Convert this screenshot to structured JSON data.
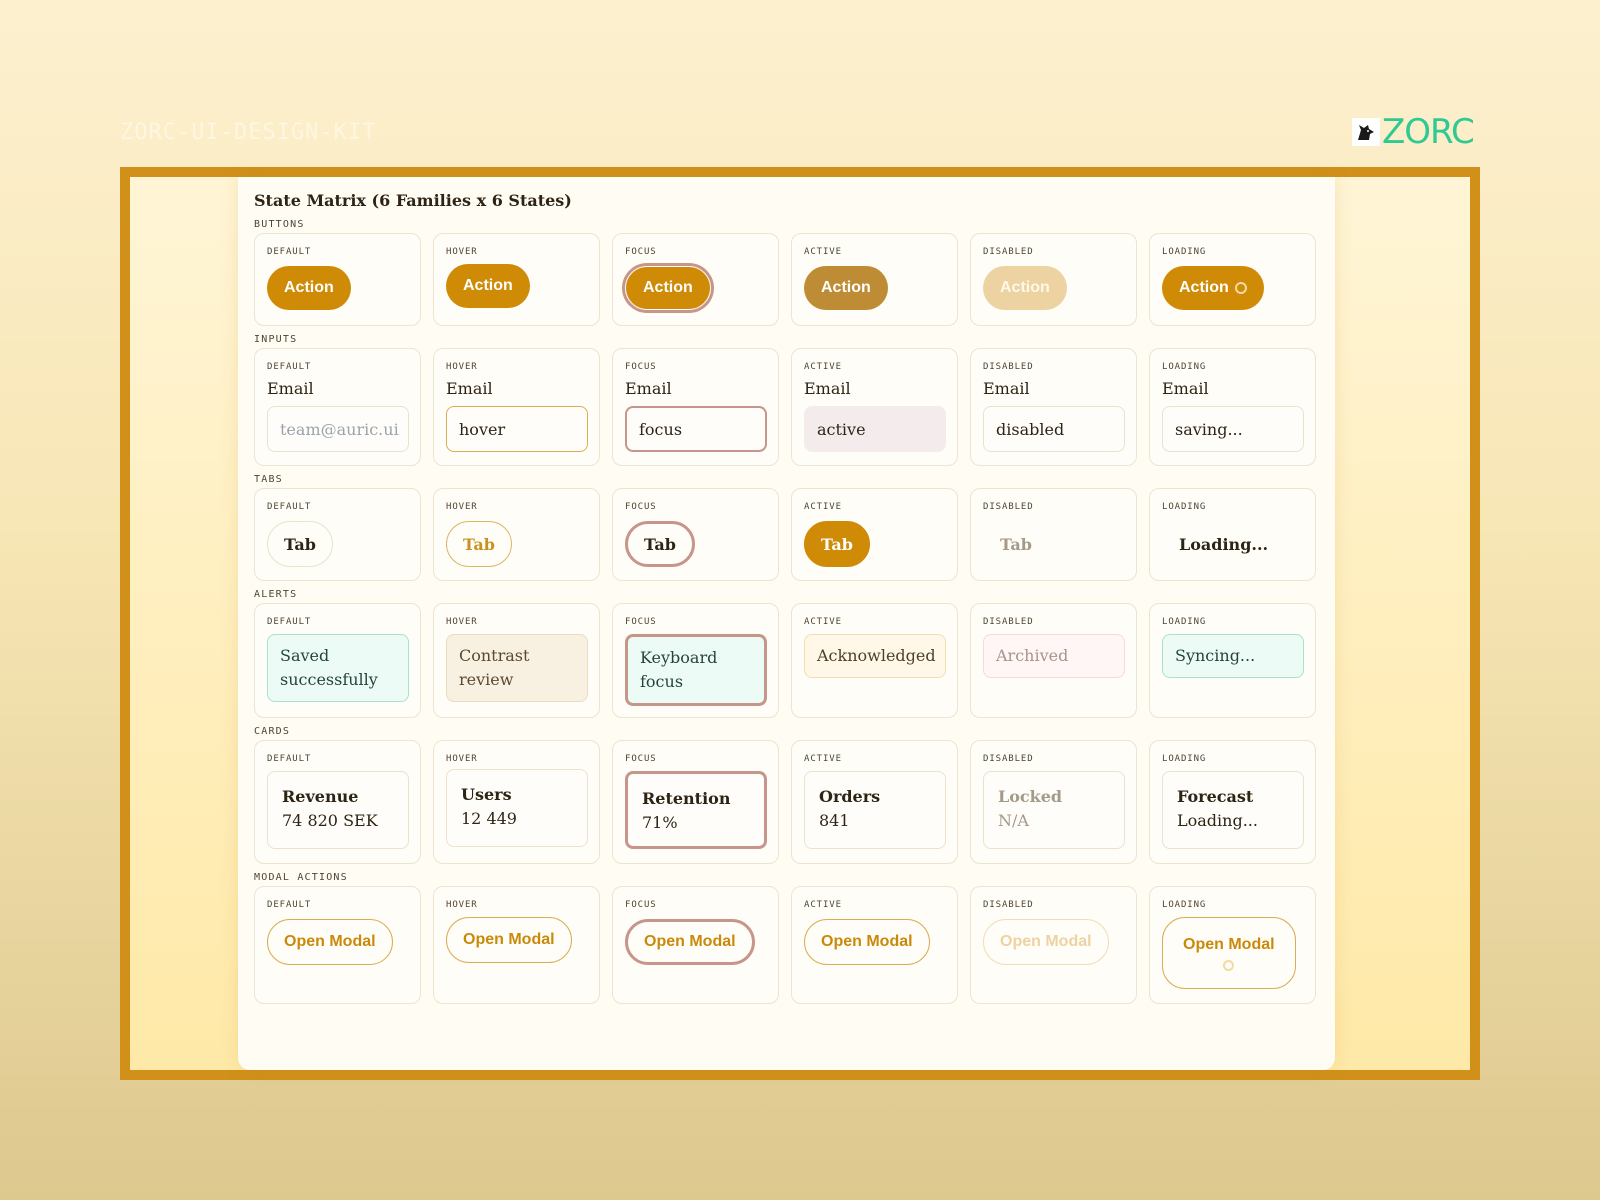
{
  "kit_title": "ZORC-UI-DESIGN-KIT",
  "brand": {
    "name": "ZORC",
    "icon": "wolf-logo-icon"
  },
  "panel_title": "State Matrix (6 Families x 6 States)",
  "states": [
    "DEFAULT",
    "HOVER",
    "FOCUS",
    "ACTIVE",
    "DISABLED",
    "LOADING"
  ],
  "sections": {
    "buttons": {
      "label": "BUTTONS",
      "items": [
        "Action",
        "Action",
        "Action",
        "Action",
        "Action",
        "Action"
      ]
    },
    "inputs": {
      "label": "INPUTS",
      "field_label": "Email",
      "values": [
        "team@auric.ui",
        "hover",
        "focus",
        "active",
        "disabled",
        "saving..."
      ]
    },
    "tabs": {
      "label": "TABS",
      "items": [
        "Tab",
        "Tab",
        "Tab",
        "Tab",
        "Tab",
        "Loading..."
      ]
    },
    "alerts": {
      "label": "ALERTS",
      "items": [
        [
          "Saved",
          "successfully"
        ],
        [
          "Contrast",
          "review"
        ],
        [
          "Keyboard",
          "focus"
        ],
        [
          "Acknowledged"
        ],
        [
          "Archived"
        ],
        [
          "Syncing..."
        ]
      ]
    },
    "cards": {
      "label": "CARDS",
      "items": [
        {
          "title": "Revenue",
          "value": "74 820 SEK"
        },
        {
          "title": "Users",
          "value": "12 449"
        },
        {
          "title": "Retention",
          "value": "71%"
        },
        {
          "title": "Orders",
          "value": "841"
        },
        {
          "title": "Locked",
          "value": "N/A"
        },
        {
          "title": "Forecast",
          "value": "Loading..."
        }
      ]
    },
    "modal": {
      "label": "MODAL ACTIONS",
      "items": [
        "Open Modal",
        "Open Modal",
        "Open Modal",
        "Open Modal",
        "Open Modal",
        "Open Modal"
      ]
    }
  },
  "colors": {
    "accent": "#cf8a06",
    "frame": "#d0901a",
    "focus_ring": "#c7968a",
    "brand": "#2fc994",
    "success_bg": "#edfbf6"
  }
}
